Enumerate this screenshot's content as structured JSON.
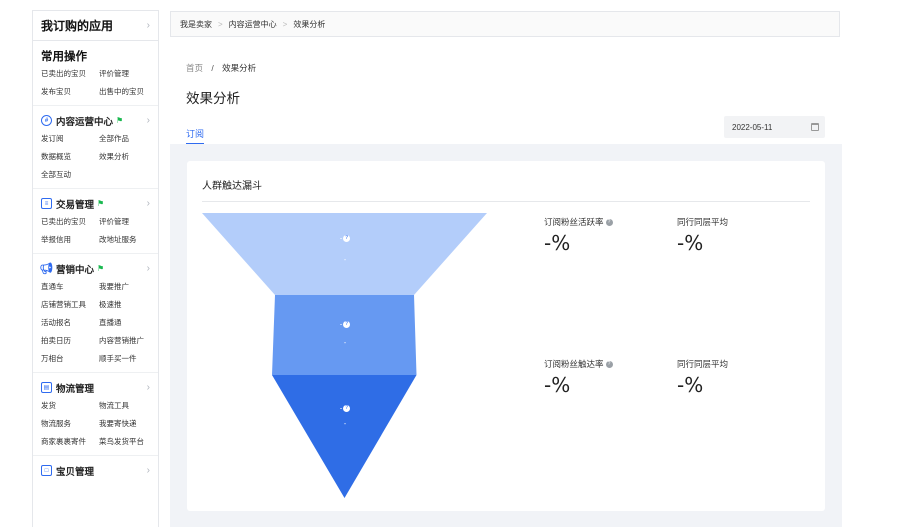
{
  "sidebar": {
    "title": "我订购的应用",
    "common": {
      "title": "常用操作",
      "links": [
        "已卖出的宝贝",
        "评价管理",
        "发布宝贝",
        "出售中的宝贝"
      ]
    },
    "sections": [
      {
        "title": "内容运营中心",
        "icon": "subscription-icon",
        "links": [
          "发订阅",
          "全部作品",
          "数据概览",
          "效果分析",
          "全部互动"
        ]
      },
      {
        "title": "交易管理",
        "icon": "trade-icon",
        "links": [
          "已卖出的宝贝",
          "评价管理",
          "举报信用",
          "改地址服务"
        ]
      },
      {
        "title": "营销中心",
        "icon": "marketing-icon",
        "links": [
          "直通车",
          "我要推广",
          "店铺营销工具",
          "极速推",
          "活动报名",
          "直播通",
          "拍卖日历",
          "内容营销推广",
          "万相台",
          "顺手买一件"
        ]
      },
      {
        "title": "物流管理",
        "icon": "logistics-icon",
        "links": [
          "发货",
          "物流工具",
          "物流服务",
          "我要寄快递",
          "商家裹裹寄件",
          "菜鸟发货平台"
        ]
      },
      {
        "title": "宝贝管理",
        "icon": "goods-icon",
        "links": []
      }
    ]
  },
  "topbar": {
    "crumbs": [
      "我是卖家",
      "内容运营中心",
      "效果分析"
    ]
  },
  "main": {
    "breadcrumb_home": "首页",
    "breadcrumb_sep": "/",
    "breadcrumb_current": "效果分析",
    "title": "效果分析",
    "tab": "订阅",
    "date": "2022-05-11"
  },
  "card": {
    "title": "人群触达漏斗",
    "funnel": [
      {
        "label": "-",
        "value": "-",
        "color": "#b3cdfa"
      },
      {
        "label": "-",
        "value": "-",
        "color": "#6699f2"
      },
      {
        "label": "-",
        "value": "-",
        "color": "#2f6de6"
      }
    ],
    "metrics": [
      {
        "label": "订阅粉丝活跃率",
        "value": "-%",
        "has_help": true
      },
      {
        "label": "同行同层平均",
        "value": "-%",
        "has_help": false
      },
      {
        "label": "订阅粉丝触达率",
        "value": "-%",
        "has_help": true
      },
      {
        "label": "同行同层平均",
        "value": "-%",
        "has_help": false
      }
    ]
  }
}
